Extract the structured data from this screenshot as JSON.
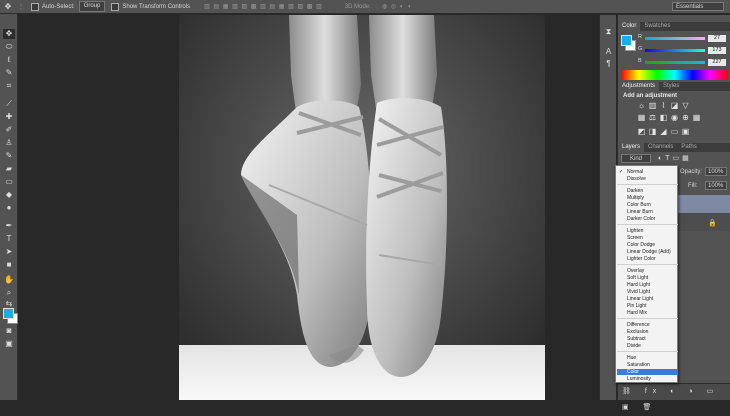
{
  "options_bar": {
    "auto_select_label": "Auto-Select:",
    "auto_select_value": "Group",
    "transform_label": "Show Transform Controls",
    "mode_3d_label": "3D Mode:",
    "workspace": "Essentials"
  },
  "color_panel": {
    "tabs": [
      "Color",
      "Swatches"
    ],
    "r_label": "R",
    "g_label": "G",
    "b_label": "B",
    "r": "27",
    "g": "173",
    "b": "227",
    "foreground": "#1badE3"
  },
  "adjustments_panel": {
    "tabs": [
      "Adjustments",
      "Styles"
    ],
    "heading": "Add an adjustment"
  },
  "layers_panel": {
    "tabs": [
      "Layers",
      "Channels",
      "Paths"
    ],
    "kind_label": "Kind",
    "opacity_label": "Opacity:",
    "opacity_value": "100%",
    "fill_label": "Fill:",
    "fill_value": "100%"
  },
  "blend_modes": {
    "groups": [
      [
        "Normal",
        "Dissolve"
      ],
      [
        "Darken",
        "Multiply",
        "Color Burn",
        "Linear Burn",
        "Darker Color"
      ],
      [
        "Lighten",
        "Screen",
        "Color Dodge",
        "Linear Dodge (Add)",
        "Lighter Color"
      ],
      [
        "Overlay",
        "Soft Light",
        "Hard Light",
        "Vivid Light",
        "Linear Light",
        "Pin Light",
        "Hard Mix"
      ],
      [
        "Difference",
        "Exclusion",
        "Subtract",
        "Divide"
      ],
      [
        "Hue",
        "Saturation",
        "Color",
        "Luminosity"
      ]
    ],
    "checked": "Normal",
    "highlighted": "Color"
  },
  "colors": {
    "ui_panel": "#535353",
    "ui_dark": "#282828",
    "accent": "#3a7bd5"
  }
}
